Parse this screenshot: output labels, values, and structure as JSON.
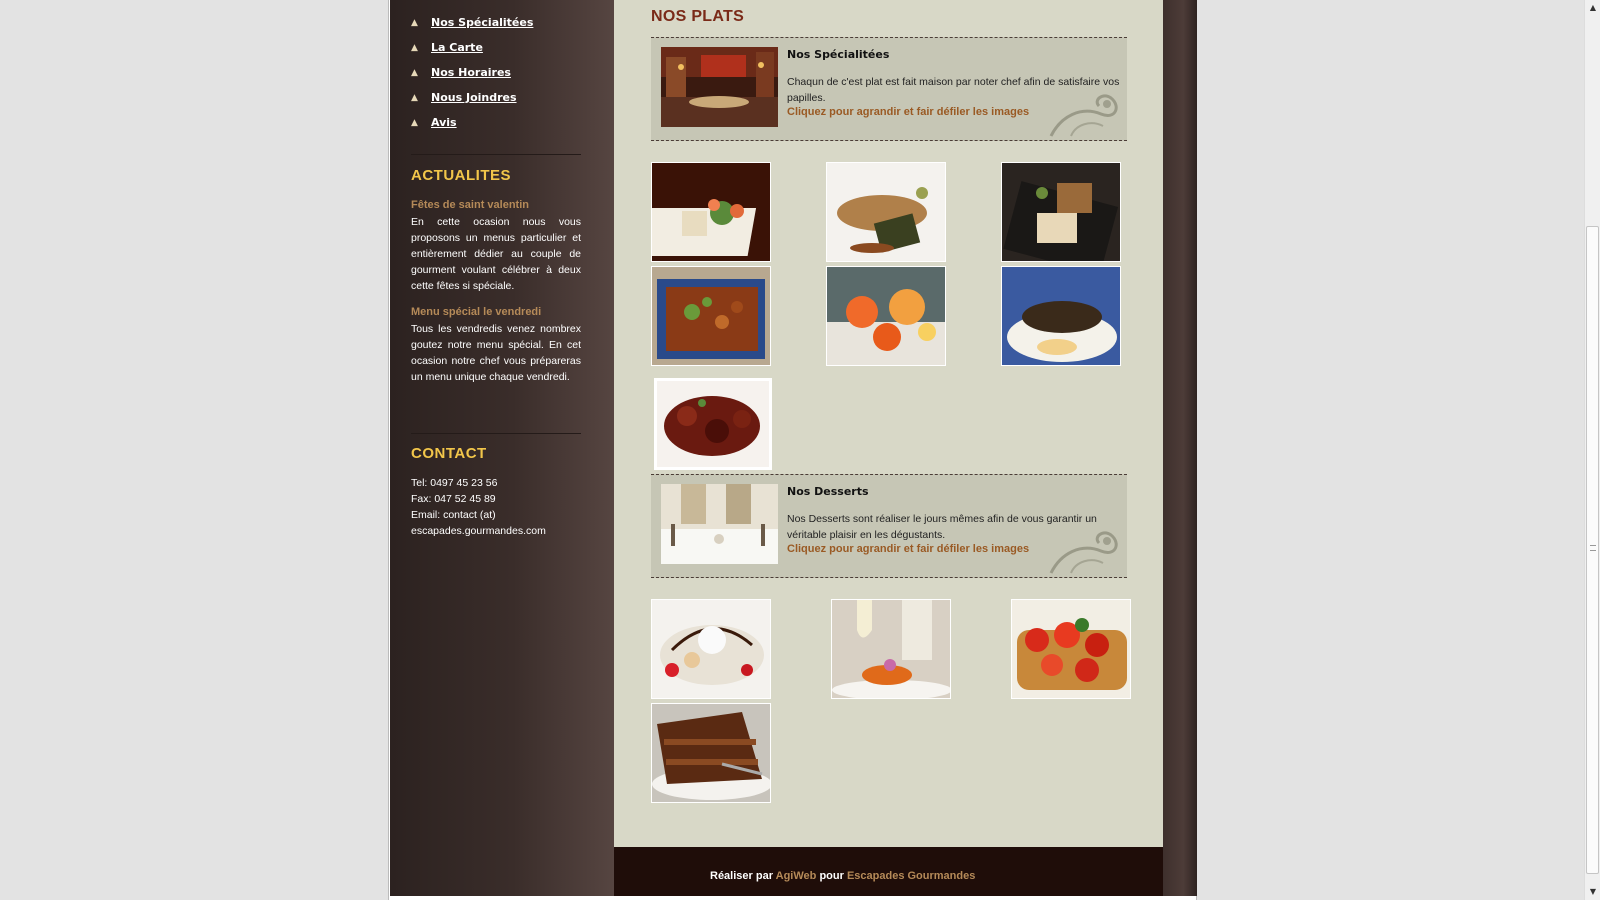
{
  "nav": {
    "items": [
      {
        "label": "Nos Spécialitées"
      },
      {
        "label": "La Carte"
      },
      {
        "label": "Nos Horaires"
      },
      {
        "label": "Nous Joindres"
      },
      {
        "label": "Avis"
      }
    ]
  },
  "news": {
    "title": "ACTUALITES",
    "items": [
      {
        "title": "Fêtes de saint valentin",
        "body": "En cette ocasion nous vous proposons un menus particulier et entièrement dédier au couple de gourment voulant célébrer à deux cette fêtes si spéciale."
      },
      {
        "title": "Menu spécial le vendredi",
        "body": "Tous les vendredis venez nombrex goutez notre menu spécial. En cet ocasion notre chef vous prépareras un menu unique chaque vendredi."
      }
    ]
  },
  "contact": {
    "title": "CONTACT",
    "tel": "Tel:  0497 45 23 56",
    "fax": "Fax: 047 52 45 89",
    "email": "Email: contact (at) escapades.gourmandes.com"
  },
  "main": {
    "title": "NOS PLATS",
    "specialites": {
      "title": "Nos Spécialitées",
      "text": "Chaqun de c'est plat est fait maison par noter chef afin de satisfaire vos papilles.",
      "link": "Cliquez pour agrandir et fair défiler les images"
    },
    "desserts": {
      "title": "Nos Desserts",
      "text": "Nos Desserts sont réaliser le jours mêmes afin de vous garantir un véritable plaisir en les dégustants.",
      "link": "Cliquez pour agrandir et fair défiler les images"
    }
  },
  "footer": {
    "prefix": "Réaliser par ",
    "agency": "AgiWeb",
    "middle": " pour ",
    "client": "Escapades Gourmandes"
  },
  "colors": {
    "accent_title": "#7a2a18",
    "accent_link": "#9a5a24",
    "side_title": "#f2c64a",
    "main_bg": "#d8d8c7",
    "sidebar_bg": "#3a2d2a",
    "footer_bg": "#1f0d09"
  },
  "icons": {
    "nav_bullet": "triangle-icon",
    "scroll_up": "arrow-up-icon",
    "scroll_down": "arrow-down-icon"
  }
}
